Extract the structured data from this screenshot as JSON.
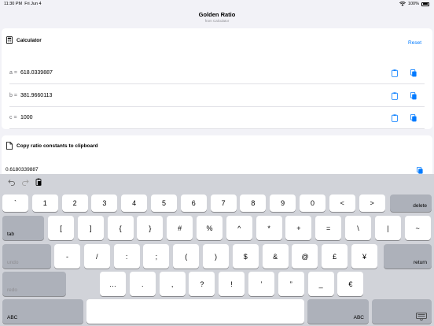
{
  "status": {
    "time": "11:30 PM",
    "date": "Fri Jun 4",
    "battery": "100%"
  },
  "nav": {
    "title": "Golden Ratio",
    "subtitle": "from Calculator"
  },
  "calculator": {
    "title": "Calculator",
    "reset_label": "Reset",
    "rows": [
      {
        "label": "a =",
        "value": "618.0339887"
      },
      {
        "label": "b =",
        "value": "381.9660113"
      },
      {
        "label": "c =",
        "value": "1000"
      }
    ]
  },
  "constants": {
    "title": "Copy ratio constants to clipboard",
    "value": "0.6180339887"
  },
  "keyboard": {
    "row1": [
      "`",
      "1",
      "2",
      "3",
      "4",
      "5",
      "6",
      "7",
      "8",
      "9",
      "0",
      "<",
      ">"
    ],
    "delete_label": "delete",
    "tab_label": "tab",
    "row2": [
      "[",
      "]",
      "{",
      "}",
      "#",
      "%",
      "^",
      "*",
      "+",
      "=",
      "\\",
      "|",
      "~"
    ],
    "undo_label": "undo",
    "row3": [
      "-",
      "/",
      ":",
      ";",
      "(",
      ")",
      "$",
      "&",
      "@",
      "£",
      "¥"
    ],
    "return_label": "return",
    "redo_label": "redo",
    "row4": [
      "…",
      ".",
      ",",
      "?",
      "!",
      "’",
      "”",
      "_",
      "€"
    ],
    "abc_label": "ABC"
  }
}
